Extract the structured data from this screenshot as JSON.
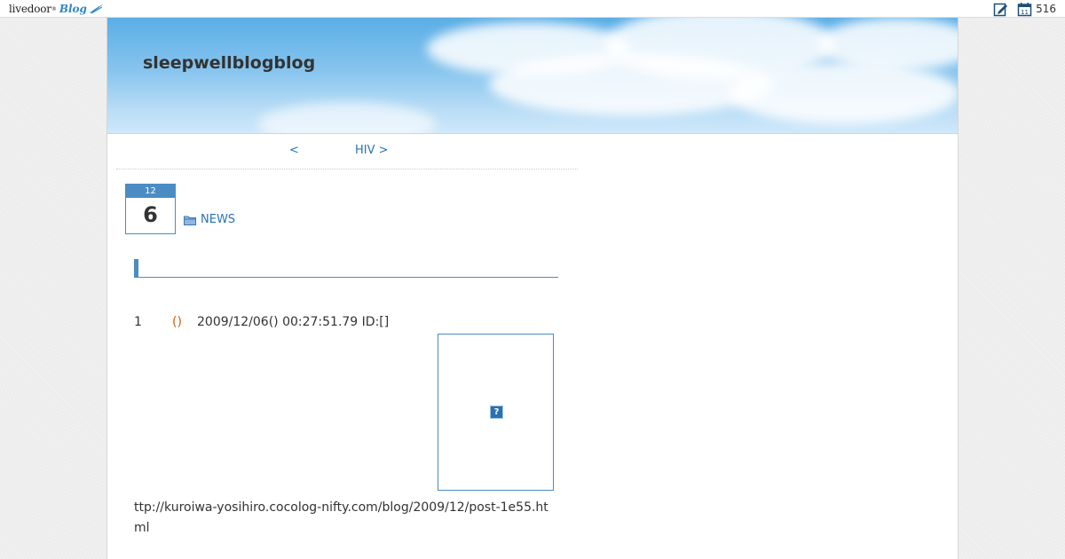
{
  "topbar": {
    "logo_word": "livedoor",
    "logo_reg": "®",
    "logo_blog": "Blog",
    "count": "516",
    "icons": [
      "edit-icon",
      "calendar-icon"
    ]
  },
  "header": {
    "title": "sleepwellblogblog"
  },
  "pager": {
    "prev": "<",
    "next": "HIV >"
  },
  "entry": {
    "date_month": "12",
    "date_day": "6",
    "category": "NEWS",
    "post_number": "1",
    "post_name": "()",
    "post_meta": "2009/12/06() 00:27:51.79 ID:[]",
    "broken_image_glyph": "?",
    "url_text": "ttp://kuroiwa-yosihiro.cocolog-nifty.com/blog/2009/12/post-1e55.html"
  },
  "colors": {
    "accent": "#4b8cc4",
    "link": "#2a72b5",
    "name": "#d45a00"
  }
}
